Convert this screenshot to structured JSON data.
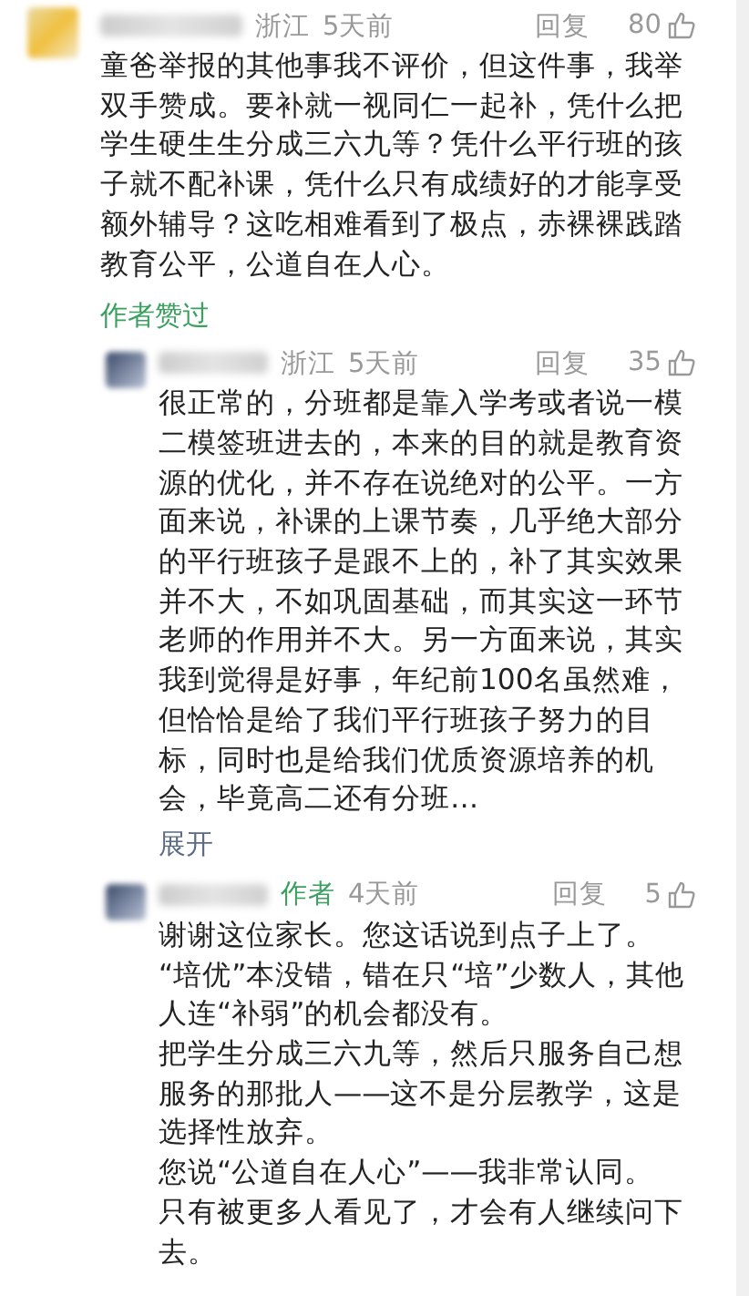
{
  "comments": [
    {
      "location": "浙江",
      "time": "5天前",
      "reply_label": "回复",
      "likes": "80",
      "paragraphs": [
        "童爸举报的其他事我不评价，但这件事，我举双手赞成。要补就一视同仁一起补，凭什么把学生硬生生分成三六九等？凭什么平行班的孩子就不配补课，凭什么只有成绩好的才能享受额外辅导？这吃相难看到了极点，赤裸裸践踏教育公平，公道自在人心。"
      ],
      "author_liked": "作者赞过",
      "replies": [
        {
          "location": "浙江",
          "time": "5天前",
          "reply_label": "回复",
          "likes": "35",
          "paragraphs": [
            "很正常的，分班都是靠入学考或者说一模二模签班进去的，本来的目的就是教育资源的优化，并不存在说绝对的公平。一方面来说，补课的上课节奏，几乎绝大部分的平行班孩子是跟不上的，补了其实效果并不大，不如巩固基础，而其实这一环节老师的作用并不大。另一方面来说，其实我到觉得是好事，年纪前100名虽然难，但恰恰是给了我们平行班孩子努力的目标，同时也是给我们优质资源培养的机会，毕竟高二还有分班…"
          ],
          "expand": "展开"
        },
        {
          "author_badge": "作者",
          "time": "4天前",
          "reply_label": "回复",
          "likes": "5",
          "paragraphs": [
            "谢谢这位家长。您这话说到点子上了。",
            "“培优”本没错，错在只“培”少数人，其他人连“补弱”的机会都没有。",
            "把学生分成三六九等，然后只服务自己想服务的那批人——这不是分层教学，这是选择性放弃。",
            "您说“公道自在人心”——我非常认同。",
            "只有被更多人看见了，才会有人继续问下去。"
          ]
        }
      ]
    }
  ]
}
